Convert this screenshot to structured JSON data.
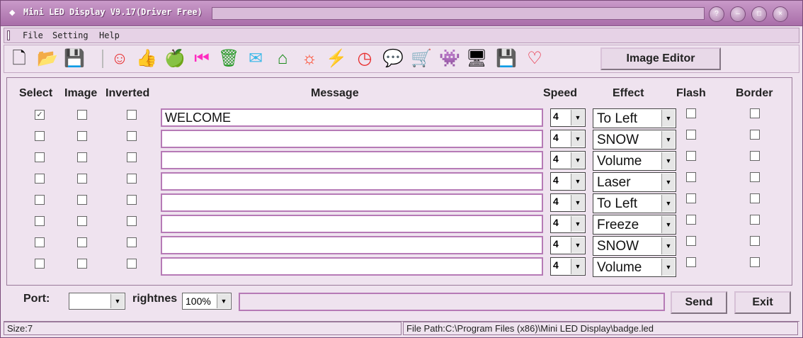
{
  "window": {
    "title": "Mini LED Display V9.17(Driver Free)"
  },
  "menu": {
    "items": [
      "File",
      "Setting",
      "Help"
    ]
  },
  "toolbar": {
    "icons": [
      {
        "name": "new-file-icon",
        "glyph": "🗋",
        "color": "#000000"
      },
      {
        "name": "open-folder-icon",
        "glyph": "📂",
        "color": "#000000"
      },
      {
        "name": "save-icon",
        "glyph": "💾",
        "color": "#000000"
      },
      {
        "name": "smiley-icon",
        "glyph": "☺",
        "color": "#e83030"
      },
      {
        "name": "thumbs-up-icon",
        "glyph": "👍",
        "color": "#b8961e"
      },
      {
        "name": "apple-icon",
        "glyph": "🍏",
        "color": "#39c43a"
      },
      {
        "name": "play-back-icon",
        "glyph": "⏮",
        "color": "#ff2bc0"
      },
      {
        "name": "trash-icon",
        "glyph": "🗑",
        "color": "#2a9b2a"
      },
      {
        "name": "mail-icon",
        "glyph": "✉",
        "color": "#38b8e8"
      },
      {
        "name": "home-icon",
        "glyph": "⌂",
        "color": "#1a8a1a"
      },
      {
        "name": "sun-icon",
        "glyph": "☼",
        "color": "#ff3a18"
      },
      {
        "name": "lightning-icon",
        "glyph": "⚡",
        "color": "#1a3cdc"
      },
      {
        "name": "clock-icon",
        "glyph": "◷",
        "color": "#e83030"
      },
      {
        "name": "chat-icon",
        "glyph": "💬",
        "color": "#d02a9a"
      },
      {
        "name": "cart-icon",
        "glyph": "🛒",
        "color": "#2aa82a"
      },
      {
        "name": "invader-icon",
        "glyph": "👾",
        "color": "#1a1a5a"
      },
      {
        "name": "computer-icon",
        "glyph": "🖥",
        "color": "#000000"
      },
      {
        "name": "floppy-icon",
        "glyph": "💾",
        "color": "#ff2bc0"
      },
      {
        "name": "heart-icon",
        "glyph": "♡",
        "color": "#e81a30"
      }
    ],
    "image_editor_label": "Image Editor"
  },
  "table": {
    "headers": {
      "select": "Select",
      "image": "Image",
      "inverted": "Inverted",
      "message": "Message",
      "speed": "Speed",
      "effect": "Effect",
      "flash": "Flash",
      "border": "Border"
    },
    "rows": [
      {
        "select": true,
        "message": "WELCOME",
        "speed": "4",
        "effect": "To Left"
      },
      {
        "select": false,
        "message": "",
        "speed": "4",
        "effect": "SNOW"
      },
      {
        "select": false,
        "message": "",
        "speed": "4",
        "effect": "Volume"
      },
      {
        "select": false,
        "message": "",
        "speed": "4",
        "effect": "Laser"
      },
      {
        "select": false,
        "message": "",
        "speed": "4",
        "effect": "To Left"
      },
      {
        "select": false,
        "message": "",
        "speed": "4",
        "effect": "Freeze"
      },
      {
        "select": false,
        "message": "",
        "speed": "4",
        "effect": "SNOW"
      },
      {
        "select": false,
        "message": "",
        "speed": "4",
        "effect": "Volume"
      }
    ]
  },
  "footer": {
    "port_label": "Port:",
    "port_value": "",
    "brightness_label": "rightnes",
    "brightness_value": "100%",
    "send_label": "Send",
    "exit_label": "Exit"
  },
  "status": {
    "size": "Size:7",
    "file_path": "File Path:C:\\Program Files (x86)\\Mini LED Display\\badge.led"
  }
}
